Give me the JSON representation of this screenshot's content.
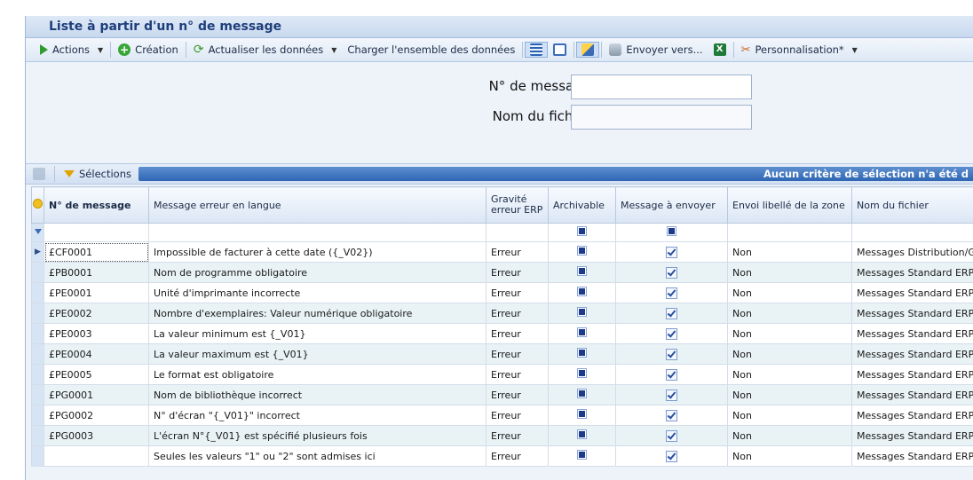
{
  "window": {
    "title": "Liste à partir d'un n° de message"
  },
  "toolbar": {
    "actions_label": "Actions",
    "creation_label": "Création",
    "refresh_label": "Actualiser les données",
    "load_all_label": "Charger l'ensemble des données",
    "send_to_label": "Envoyer vers...",
    "customize_label": "Personnalisation*"
  },
  "form": {
    "message_no_label": "N° de message",
    "message_no_value": "",
    "file_name_label": "Nom du fichier",
    "file_name_value": ""
  },
  "selection_bar": {
    "selections_label": "Sélections",
    "info": "Aucun critère de sélection n'a été d"
  },
  "grid": {
    "columns": {
      "message_no": "N° de message",
      "message_text": "Message erreur en langue",
      "severity": "Gravité erreur ERP",
      "archivable": "Archivable",
      "to_send": "Message à envoyer",
      "send_label": "Envoi libellé de la zone",
      "file_name": "Nom du fichier"
    },
    "rows": [
      {
        "no": "£CF0001",
        "text": "Impossible de facturer à cette date ({_V02})",
        "severity": "Erreur",
        "send_label": "Non",
        "file": "Messages Distribution/Ge"
      },
      {
        "no": "£PB0001",
        "text": "Nom de programme obligatoire",
        "severity": "Erreur",
        "send_label": "Non",
        "file": "Messages Standard ERP"
      },
      {
        "no": "£PE0001",
        "text": "Unité d'imprimante incorrecte",
        "severity": "Erreur",
        "send_label": "Non",
        "file": "Messages Standard ERP"
      },
      {
        "no": "£PE0002",
        "text": "Nombre d'exemplaires: Valeur numérique obligatoire",
        "severity": "Erreur",
        "send_label": "Non",
        "file": "Messages Standard ERP"
      },
      {
        "no": "£PE0003",
        "text": "La valeur minimum est {_V01}",
        "severity": "Erreur",
        "send_label": "Non",
        "file": "Messages Standard ERP"
      },
      {
        "no": "£PE0004",
        "text": "La valeur maximum est {_V01}",
        "severity": "Erreur",
        "send_label": "Non",
        "file": "Messages Standard ERP"
      },
      {
        "no": "£PE0005",
        "text": "Le format est obligatoire",
        "severity": "Erreur",
        "send_label": "Non",
        "file": "Messages Standard ERP"
      },
      {
        "no": "£PG0001",
        "text": "Nom de bibliothèque incorrect",
        "severity": "Erreur",
        "send_label": "Non",
        "file": "Messages Standard ERP"
      },
      {
        "no": "£PG0002",
        "text": "N° d'écran \"{_V01}\" incorrect",
        "severity": "Erreur",
        "send_label": "Non",
        "file": "Messages Standard ERP"
      },
      {
        "no": "£PG0003",
        "text": "L'écran N°{_V01} est spécifié plusieurs fois",
        "severity": "Erreur",
        "send_label": "Non",
        "file": "Messages Standard ERP"
      },
      {
        "no": "",
        "text": "Seules les valeurs \"1\" ou \"2\" sont admises ici",
        "severity": "Erreur",
        "send_label": "Non",
        "file": "Messages Standard ERP"
      }
    ]
  }
}
